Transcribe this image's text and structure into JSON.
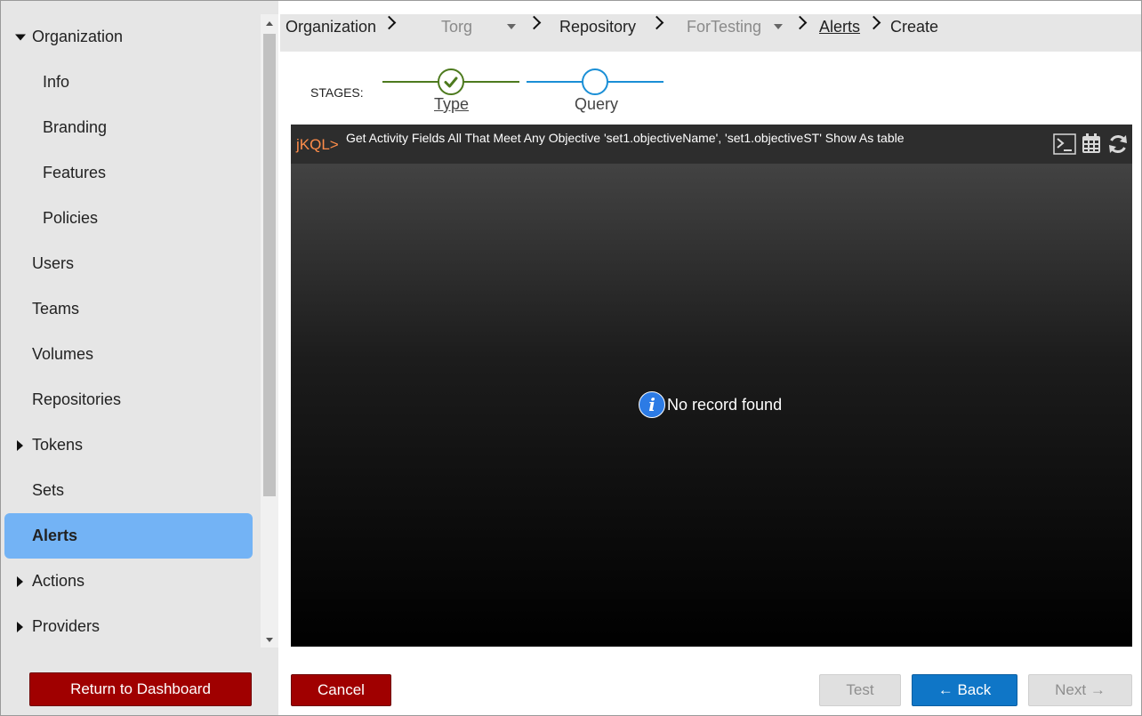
{
  "sidebar": {
    "items": [
      {
        "label": "Organization",
        "caret": "down"
      },
      {
        "label": "Info"
      },
      {
        "label": "Branding"
      },
      {
        "label": "Features"
      },
      {
        "label": "Policies"
      },
      {
        "label": "Users"
      },
      {
        "label": "Teams"
      },
      {
        "label": "Volumes"
      },
      {
        "label": "Repositories"
      },
      {
        "label": "Tokens",
        "caret": "right"
      },
      {
        "label": "Sets"
      },
      {
        "label": "Alerts",
        "active": true
      },
      {
        "label": "Actions",
        "caret": "right"
      },
      {
        "label": "Providers",
        "caret": "right"
      }
    ],
    "return_label": "Return to Dashboard"
  },
  "breadcrumb": {
    "organization": "Organization",
    "org_name": "Torg",
    "repository": "Repository",
    "repo_name": "ForTesting",
    "alerts": "Alerts",
    "create": "Create"
  },
  "stages": {
    "label": "STAGES:",
    "items": [
      {
        "name": "Type",
        "state": "complete"
      },
      {
        "name": "Query",
        "state": "current"
      }
    ],
    "complete_color": "#4d7a1e",
    "current_color": "#1a8fd6"
  },
  "query": {
    "prompt": "jKQL>",
    "text": "Get Activity Fields All That Meet Any Objective 'set1.objectiveName', 'set1.objectiveST' Show As table",
    "tools": [
      "terminal-icon",
      "calendar-icon",
      "refresh-icon"
    ],
    "empty_message": "No record found"
  },
  "footer": {
    "cancel_label": "Cancel",
    "test_label": "Test",
    "back_label": "← Back",
    "next_label": "Next →"
  }
}
